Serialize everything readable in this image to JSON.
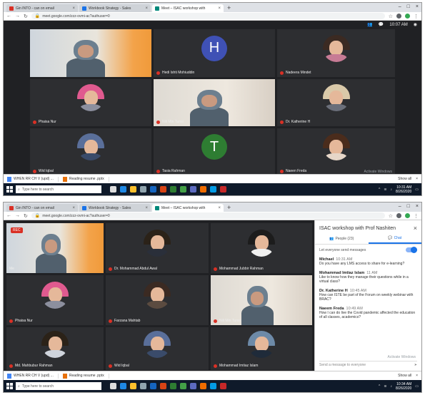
{
  "colors": {
    "chrome_bg": "#dee1e6",
    "meet_bg": "#202124",
    "tile_bg": "#2d2e31",
    "accent": "#1a73e8",
    "record": "#d93025",
    "taskbar": "#0f1a2a"
  },
  "top": {
    "tabs": [
      {
        "title": "Gin INTO - can on email",
        "icon": "mail-icon",
        "color": "#d93025"
      },
      {
        "title": "Workbook Strategy - Sales",
        "icon": "doc-icon",
        "color": "#1a73e8"
      },
      {
        "title": "Meet – ISAC workshop with",
        "icon": "meet-icon",
        "color": "#00897b"
      }
    ],
    "url": "meet.google.com/zzz-ovmi-ac?authuser=0",
    "clock": "10:07 AM",
    "participants": [
      {
        "name": "",
        "kind": "video"
      },
      {
        "name": "Hedi Ishti Mohiuddin",
        "kind": "letter",
        "letter": "H",
        "color": "#3f51b5"
      },
      {
        "name": "Nadeera Mindet",
        "kind": "photo",
        "hair": "#3b2a22",
        "body": "#c77b95"
      },
      {
        "name": "Phaisa Nur",
        "kind": "photo",
        "hair": "#e05a8f",
        "body": "#8c8f9e"
      },
      {
        "name": "Nili Min Tunsi",
        "kind": "video2"
      },
      {
        "name": "Dr. Katherine H",
        "kind": "photo",
        "hair": "#d9c9a9",
        "body": "#6b6f7a"
      },
      {
        "name": "Wid Iqbal",
        "kind": "photo",
        "hair": "#5a6f9a",
        "body": "#3a4b6a"
      },
      {
        "name": "Tasia Rahman",
        "kind": "letter",
        "letter": "T",
        "color": "#2e7d32"
      },
      {
        "name": "Naeen Freda",
        "kind": "photo",
        "hair": "#4a2c1c",
        "body": "#e6d6c8"
      }
    ],
    "watermark": "Activate Windows",
    "downloads": [
      "WHEN RR CH V (upd) ...",
      "Reading resume .pptx"
    ],
    "show_all": "Show all",
    "search_placeholder": "Type here to search",
    "time": "10:31 AM",
    "date": "8/26/2020"
  },
  "bottom": {
    "tabs": [
      {
        "title": "Gin INTO - can on email",
        "icon": "mail-icon",
        "color": "#d93025"
      },
      {
        "title": "Workbook Strategy - Sales",
        "icon": "doc-icon",
        "color": "#1a73e8"
      },
      {
        "title": "Meet – ISAC workshop with",
        "icon": "meet-icon",
        "color": "#00897b"
      }
    ],
    "url": "meet.google.com/zzz-ovmi-ac?authuser=0",
    "rec_label": "REC",
    "participants": [
      {
        "name": "Me",
        "kind": "video"
      },
      {
        "name": "Dr. Mohammad Abdul Awal",
        "kind": "photo",
        "hair": "#2b2218",
        "body": "#2a2f3a"
      },
      {
        "name": "Mohammad Jubbir Rahman",
        "kind": "photo",
        "hair": "#1c1c1c",
        "body": "#f0f0f0"
      },
      {
        "name": "Phaisa Nur",
        "kind": "photo",
        "hair": "#e05a8f",
        "body": "#8c8f9e"
      },
      {
        "name": "Farzana Mahtab",
        "kind": "photo",
        "hair": "#3b2a22",
        "body": "#5b4b40"
      },
      {
        "name": "Nili Min Tunsi",
        "kind": "video2"
      },
      {
        "name": "Md. Mahbubur Rahman",
        "kind": "photo",
        "hair": "#2b2218",
        "body": "#cfd4dc"
      },
      {
        "name": "Wid Iqbal",
        "kind": "photo",
        "hair": "#5a6f9a",
        "body": "#3a4b6a"
      },
      {
        "name": "Mohammad Imtiaz Islam",
        "kind": "photo",
        "hair": "#6d8aa8",
        "body": "#1f2b3a"
      }
    ],
    "panel": {
      "title": "ISAC workshop with Prof Nashiten",
      "tab_people": "People (23)",
      "tab_chat": "Chat",
      "toggle_label": "Let everyone send messages",
      "messages": [
        {
          "who": "Michael",
          "time": "10:31 AM",
          "text": "Do you have any LMS access to share for e-learning?"
        },
        {
          "who": "Mohammad Imtiaz Islam",
          "time": "11 AM",
          "text": "Like to know how they manage their questions while in a virtual class?"
        },
        {
          "who": "Dr. Katherine H",
          "time": "10:45 AM",
          "text": "How can ISTE be part of the Forum on weekly webinar with BRAC?"
        },
        {
          "who": "Naeem Freda",
          "time": "10:49 AM",
          "text": "How I can do live the Covid pandemic affected the education of all classes, academics?"
        }
      ],
      "composer_placeholder": "Send a message to everyone"
    },
    "watermark": "Activate Windows",
    "downloads": [
      "WHEN RR CH V (upd) ...",
      "Reading resume .pptx"
    ],
    "show_all": "Show all",
    "search_placeholder": "Type here to search",
    "time": "10:34 AM",
    "date": "8/26/2020"
  }
}
